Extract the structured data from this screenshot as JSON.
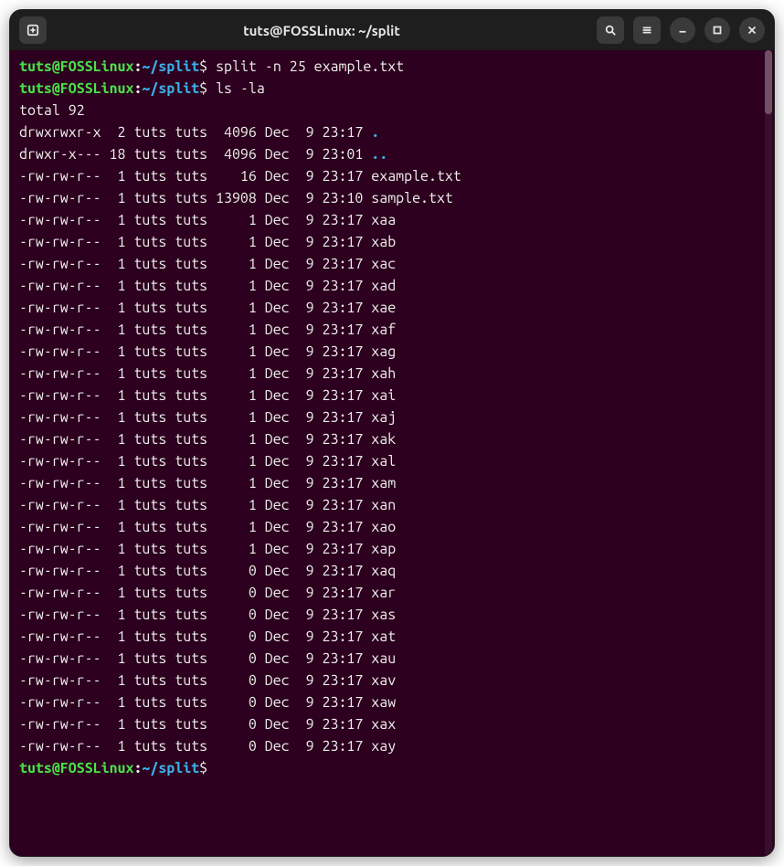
{
  "window": {
    "title": "tuts@FOSSLinux: ~/split"
  },
  "prompt": {
    "user": "tuts",
    "at": "@",
    "host": "FOSSLinux",
    "colon": ":",
    "path": "~/split",
    "dollar": "$"
  },
  "commands": [
    "split -n 25 example.txt",
    "ls -la"
  ],
  "total_line": "total 92",
  "listing": [
    {
      "perm": "drwxrwxr-x",
      "links": "2",
      "owner": "tuts",
      "group": "tuts",
      "size": "4096",
      "month": "Dec",
      "day": "9",
      "time": "23:17",
      "name": ".",
      "dir": true
    },
    {
      "perm": "drwxr-x---",
      "links": "18",
      "owner": "tuts",
      "group": "tuts",
      "size": "4096",
      "month": "Dec",
      "day": "9",
      "time": "23:01",
      "name": "..",
      "dir": true
    },
    {
      "perm": "-rw-rw-r--",
      "links": "1",
      "owner": "tuts",
      "group": "tuts",
      "size": "16",
      "month": "Dec",
      "day": "9",
      "time": "23:17",
      "name": "example.txt",
      "dir": false
    },
    {
      "perm": "-rw-rw-r--",
      "links": "1",
      "owner": "tuts",
      "group": "tuts",
      "size": "13908",
      "month": "Dec",
      "day": "9",
      "time": "23:10",
      "name": "sample.txt",
      "dir": false
    },
    {
      "perm": "-rw-rw-r--",
      "links": "1",
      "owner": "tuts",
      "group": "tuts",
      "size": "1",
      "month": "Dec",
      "day": "9",
      "time": "23:17",
      "name": "xaa",
      "dir": false
    },
    {
      "perm": "-rw-rw-r--",
      "links": "1",
      "owner": "tuts",
      "group": "tuts",
      "size": "1",
      "month": "Dec",
      "day": "9",
      "time": "23:17",
      "name": "xab",
      "dir": false
    },
    {
      "perm": "-rw-rw-r--",
      "links": "1",
      "owner": "tuts",
      "group": "tuts",
      "size": "1",
      "month": "Dec",
      "day": "9",
      "time": "23:17",
      "name": "xac",
      "dir": false
    },
    {
      "perm": "-rw-rw-r--",
      "links": "1",
      "owner": "tuts",
      "group": "tuts",
      "size": "1",
      "month": "Dec",
      "day": "9",
      "time": "23:17",
      "name": "xad",
      "dir": false
    },
    {
      "perm": "-rw-rw-r--",
      "links": "1",
      "owner": "tuts",
      "group": "tuts",
      "size": "1",
      "month": "Dec",
      "day": "9",
      "time": "23:17",
      "name": "xae",
      "dir": false
    },
    {
      "perm": "-rw-rw-r--",
      "links": "1",
      "owner": "tuts",
      "group": "tuts",
      "size": "1",
      "month": "Dec",
      "day": "9",
      "time": "23:17",
      "name": "xaf",
      "dir": false
    },
    {
      "perm": "-rw-rw-r--",
      "links": "1",
      "owner": "tuts",
      "group": "tuts",
      "size": "1",
      "month": "Dec",
      "day": "9",
      "time": "23:17",
      "name": "xag",
      "dir": false
    },
    {
      "perm": "-rw-rw-r--",
      "links": "1",
      "owner": "tuts",
      "group": "tuts",
      "size": "1",
      "month": "Dec",
      "day": "9",
      "time": "23:17",
      "name": "xah",
      "dir": false
    },
    {
      "perm": "-rw-rw-r--",
      "links": "1",
      "owner": "tuts",
      "group": "tuts",
      "size": "1",
      "month": "Dec",
      "day": "9",
      "time": "23:17",
      "name": "xai",
      "dir": false
    },
    {
      "perm": "-rw-rw-r--",
      "links": "1",
      "owner": "tuts",
      "group": "tuts",
      "size": "1",
      "month": "Dec",
      "day": "9",
      "time": "23:17",
      "name": "xaj",
      "dir": false
    },
    {
      "perm": "-rw-rw-r--",
      "links": "1",
      "owner": "tuts",
      "group": "tuts",
      "size": "1",
      "month": "Dec",
      "day": "9",
      "time": "23:17",
      "name": "xak",
      "dir": false
    },
    {
      "perm": "-rw-rw-r--",
      "links": "1",
      "owner": "tuts",
      "group": "tuts",
      "size": "1",
      "month": "Dec",
      "day": "9",
      "time": "23:17",
      "name": "xal",
      "dir": false
    },
    {
      "perm": "-rw-rw-r--",
      "links": "1",
      "owner": "tuts",
      "group": "tuts",
      "size": "1",
      "month": "Dec",
      "day": "9",
      "time": "23:17",
      "name": "xam",
      "dir": false
    },
    {
      "perm": "-rw-rw-r--",
      "links": "1",
      "owner": "tuts",
      "group": "tuts",
      "size": "1",
      "month": "Dec",
      "day": "9",
      "time": "23:17",
      "name": "xan",
      "dir": false
    },
    {
      "perm": "-rw-rw-r--",
      "links": "1",
      "owner": "tuts",
      "group": "tuts",
      "size": "1",
      "month": "Dec",
      "day": "9",
      "time": "23:17",
      "name": "xao",
      "dir": false
    },
    {
      "perm": "-rw-rw-r--",
      "links": "1",
      "owner": "tuts",
      "group": "tuts",
      "size": "1",
      "month": "Dec",
      "day": "9",
      "time": "23:17",
      "name": "xap",
      "dir": false
    },
    {
      "perm": "-rw-rw-r--",
      "links": "1",
      "owner": "tuts",
      "group": "tuts",
      "size": "0",
      "month": "Dec",
      "day": "9",
      "time": "23:17",
      "name": "xaq",
      "dir": false
    },
    {
      "perm": "-rw-rw-r--",
      "links": "1",
      "owner": "tuts",
      "group": "tuts",
      "size": "0",
      "month": "Dec",
      "day": "9",
      "time": "23:17",
      "name": "xar",
      "dir": false
    },
    {
      "perm": "-rw-rw-r--",
      "links": "1",
      "owner": "tuts",
      "group": "tuts",
      "size": "0",
      "month": "Dec",
      "day": "9",
      "time": "23:17",
      "name": "xas",
      "dir": false
    },
    {
      "perm": "-rw-rw-r--",
      "links": "1",
      "owner": "tuts",
      "group": "tuts",
      "size": "0",
      "month": "Dec",
      "day": "9",
      "time": "23:17",
      "name": "xat",
      "dir": false
    },
    {
      "perm": "-rw-rw-r--",
      "links": "1",
      "owner": "tuts",
      "group": "tuts",
      "size": "0",
      "month": "Dec",
      "day": "9",
      "time": "23:17",
      "name": "xau",
      "dir": false
    },
    {
      "perm": "-rw-rw-r--",
      "links": "1",
      "owner": "tuts",
      "group": "tuts",
      "size": "0",
      "month": "Dec",
      "day": "9",
      "time": "23:17",
      "name": "xav",
      "dir": false
    },
    {
      "perm": "-rw-rw-r--",
      "links": "1",
      "owner": "tuts",
      "group": "tuts",
      "size": "0",
      "month": "Dec",
      "day": "9",
      "time": "23:17",
      "name": "xaw",
      "dir": false
    },
    {
      "perm": "-rw-rw-r--",
      "links": "1",
      "owner": "tuts",
      "group": "tuts",
      "size": "0",
      "month": "Dec",
      "day": "9",
      "time": "23:17",
      "name": "xax",
      "dir": false
    },
    {
      "perm": "-rw-rw-r--",
      "links": "1",
      "owner": "tuts",
      "group": "tuts",
      "size": "0",
      "month": "Dec",
      "day": "9",
      "time": "23:17",
      "name": "xay",
      "dir": false
    }
  ]
}
